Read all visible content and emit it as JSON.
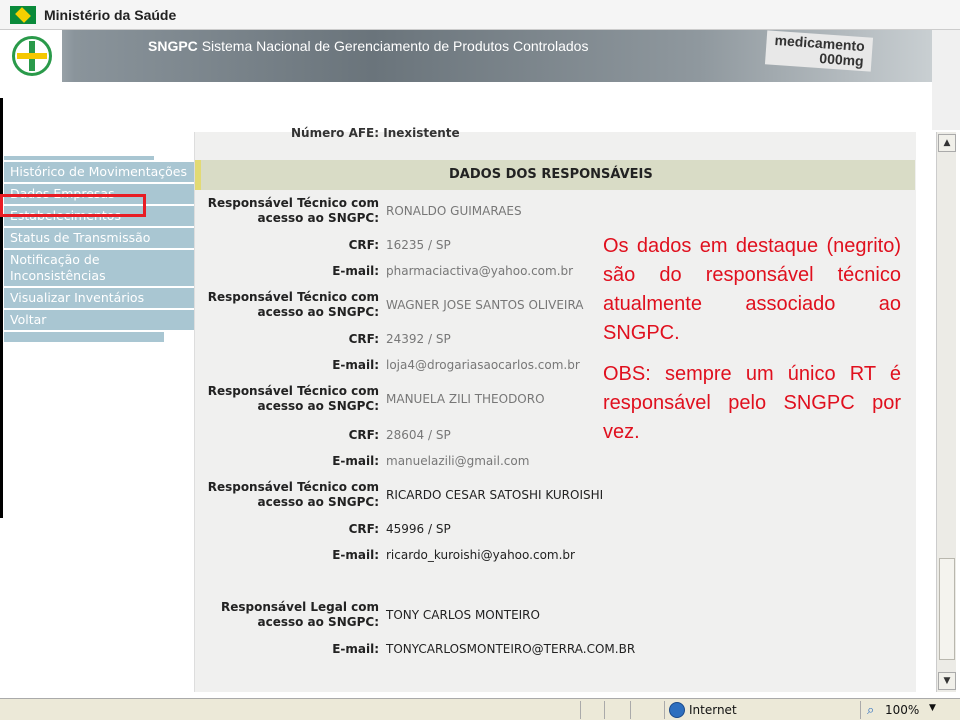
{
  "header": {
    "ministry": "Ministério da Saúde",
    "sngpc_acronym": "SNGPC",
    "sngpc_full": "Sistema Nacional de Gerenciamento de Produtos Controlados",
    "banner_word1": "medicamento",
    "banner_word2": "000mg"
  },
  "menu": {
    "items": [
      {
        "label": "Histórico de Movimentações"
      },
      {
        "label": "Dados Empresas"
      },
      {
        "label": "Estabelecimentos"
      },
      {
        "label": "Status de Transmissão"
      },
      {
        "label": "Notificação de Inconsistências"
      },
      {
        "label": "Visualizar Inventários"
      },
      {
        "label": "Voltar"
      }
    ]
  },
  "content": {
    "cut_row": "Número AFE:   Inexistente",
    "section_title": "DADOS DOS RESPONSÁVEIS",
    "label_rt": "Responsável Técnico com acesso ao SNGPC:",
    "label_crf": "CRF:",
    "label_email": "E-mail:",
    "label_legal": "Responsável Legal com acesso ao SNGPC:",
    "responsaveis": [
      {
        "nome": "RONALDO GUIMARAES",
        "crf": "16235 / SP",
        "email": "pharmaciactiva@yahoo.com.br"
      },
      {
        "nome": "WAGNER JOSE SANTOS OLIVEIRA",
        "crf": "24392 / SP",
        "email": "loja4@drogariasaocarlos.com.br"
      },
      {
        "nome": "MANUELA ZILI THEODORO",
        "crf": "28604 / SP",
        "email": "manuelazili@gmail.com"
      },
      {
        "nome": "RICARDO CESAR SATOSHI KUROISHI",
        "crf": "45996 / SP",
        "email": "ricardo_kuroishi@yahoo.com.br"
      }
    ],
    "legal": {
      "nome": "TONY CARLOS MONTEIRO",
      "email": "TONYCARLOSMONTEIRO@TERRA.COM.BR"
    }
  },
  "annotation": {
    "p1": "Os dados em destaque (negrito) são do responsável técnico atualmente associado ao SNGPC.",
    "p2": "OBS: sempre um único RT é responsável pelo SNGPC por vez."
  },
  "statusbar": {
    "zone": "Internet",
    "zoom": "100%"
  }
}
